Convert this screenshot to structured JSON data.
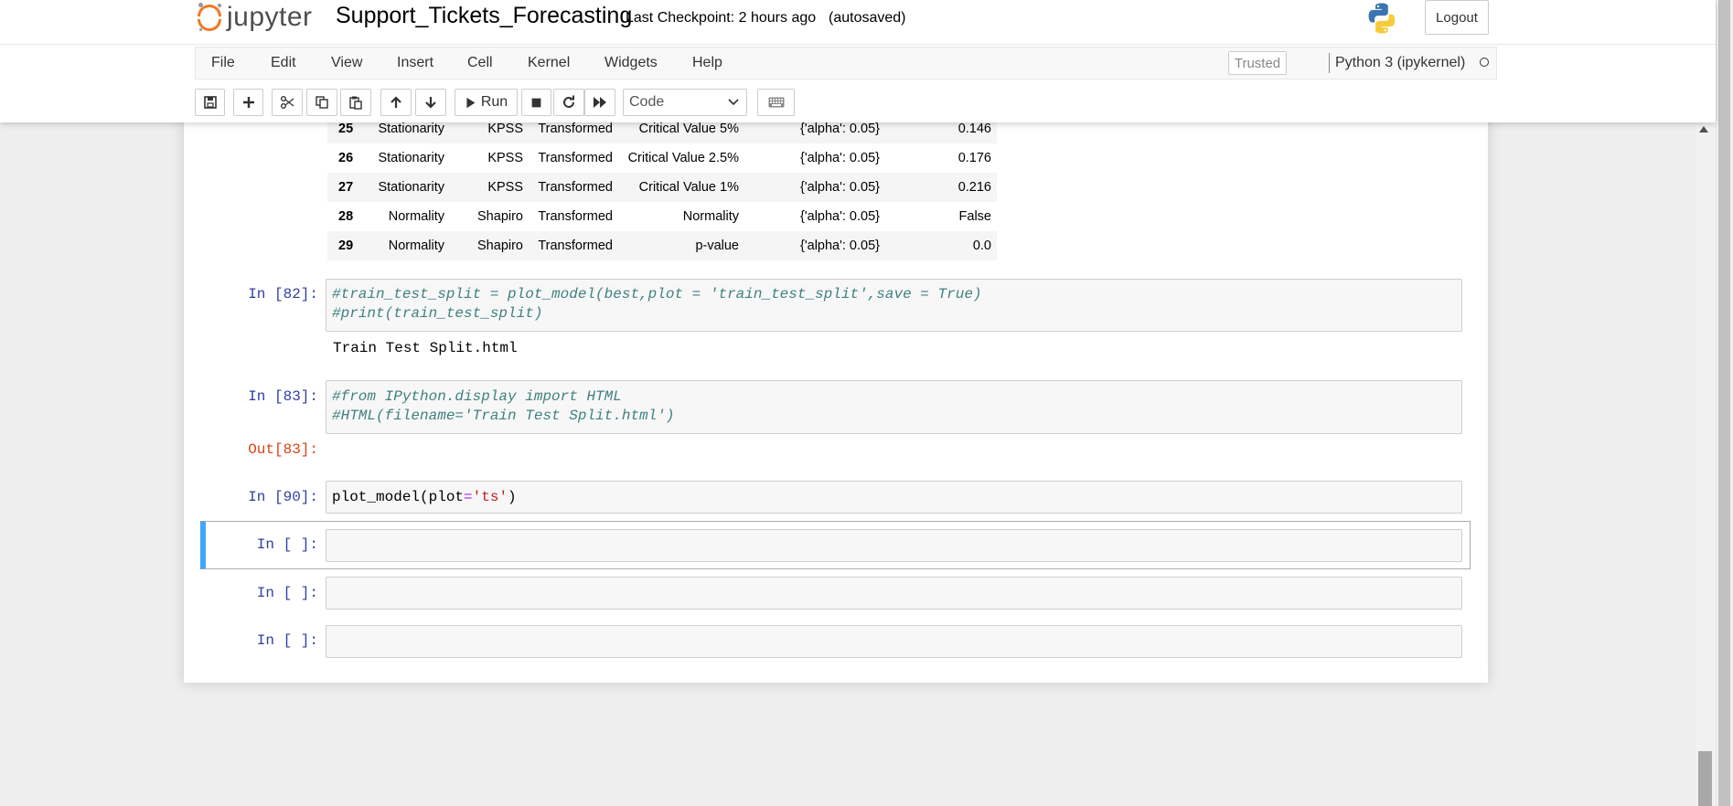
{
  "header": {
    "logo_text": "jupyter",
    "notebook_title": "Support_Tickets_Forecasting",
    "checkpoint": "Last Checkpoint: 2 hours ago",
    "autosaved": "(autosaved)",
    "logout_label": "Logout"
  },
  "menu": {
    "items": [
      "File",
      "Edit",
      "View",
      "Insert",
      "Cell",
      "Kernel",
      "Widgets",
      "Help"
    ],
    "trusted_label": "Trusted",
    "kernel_name": "Python 3 (ipykernel)"
  },
  "toolbar": {
    "run_label": "Run",
    "cell_type": "Code"
  },
  "dataframe": {
    "rows": [
      {
        "idx": "25",
        "test": "Stationarity",
        "name": "KPSS",
        "data": "Transformed",
        "property": "Critical Value 5%",
        "setting": "{'alpha': 0.05}",
        "value": "0.146"
      },
      {
        "idx": "26",
        "test": "Stationarity",
        "name": "KPSS",
        "data": "Transformed",
        "property": "Critical Value 2.5%",
        "setting": "{'alpha': 0.05}",
        "value": "0.176"
      },
      {
        "idx": "27",
        "test": "Stationarity",
        "name": "KPSS",
        "data": "Transformed",
        "property": "Critical Value 1%",
        "setting": "{'alpha': 0.05}",
        "value": "0.216"
      },
      {
        "idx": "28",
        "test": "Normality",
        "name": "Shapiro",
        "data": "Transformed",
        "property": "Normality",
        "setting": "{'alpha': 0.05}",
        "value": "False"
      },
      {
        "idx": "29",
        "test": "Normality",
        "name": "Shapiro",
        "data": "Transformed",
        "property": "p-value",
        "setting": "{'alpha': 0.05}",
        "value": "0.0"
      }
    ]
  },
  "cells": {
    "c82": {
      "prompt": "In [82]:",
      "line1": "#train_test_split = plot_model(best,plot = 'train_test_split',save = True)",
      "line2": "#print(train_test_split)",
      "output": "Train Test Split.html"
    },
    "c83": {
      "prompt": "In [83]:",
      "line1": "#from IPython.display import HTML",
      "line2": "#HTML(filename='Train Test Split.html')",
      "out_prompt": "Out[83]:"
    },
    "c90": {
      "prompt": "In [90]:",
      "code_a": "plot_model(plot",
      "code_op": "=",
      "code_str": "'ts'",
      "code_b": ")"
    },
    "empty_prompt": "In [ ]:"
  },
  "colors": {
    "accent": "#f37726",
    "prompt_in": "#303f9f",
    "prompt_out": "#d84315",
    "selected_border": "#42a5f5"
  }
}
